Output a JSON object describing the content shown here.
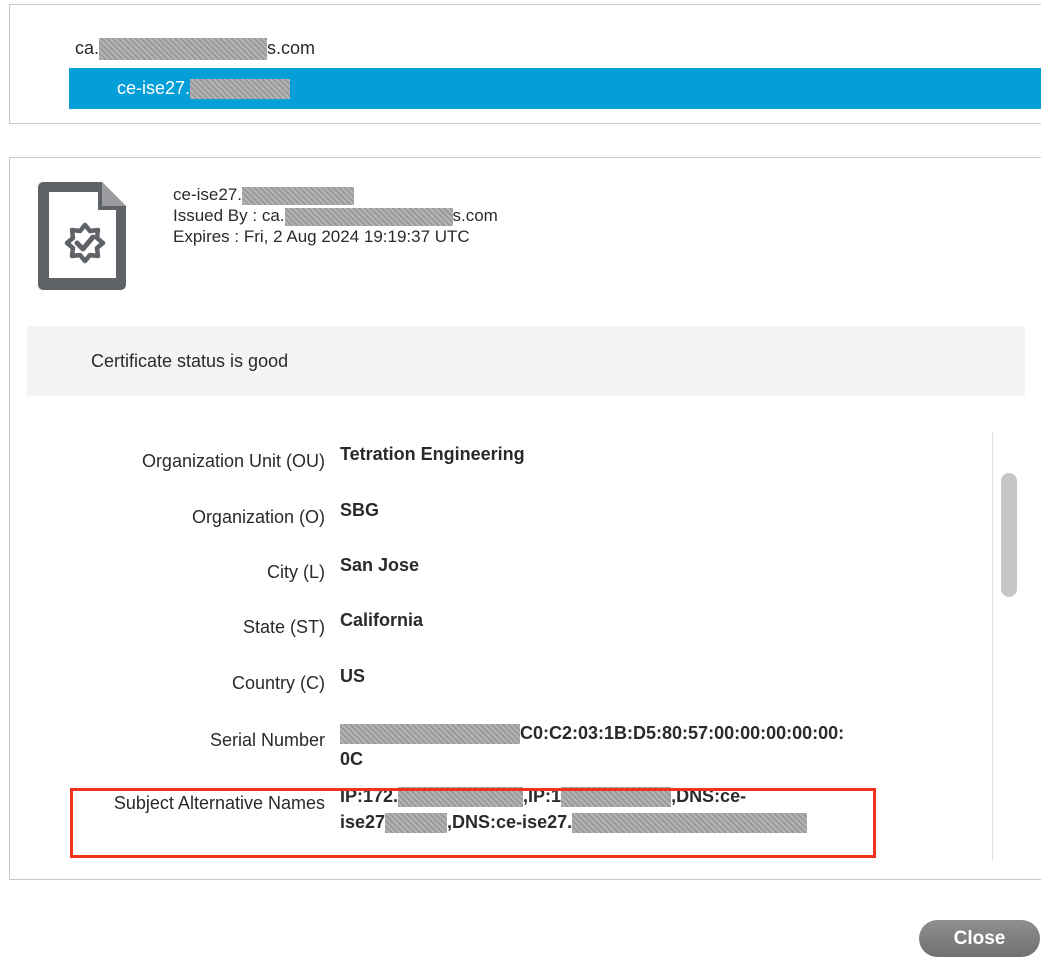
{
  "chain": {
    "root": {
      "prefix": "ca.",
      "suffix": "s.com"
    },
    "selected": {
      "prefix": "ce-ise27."
    }
  },
  "certificate": {
    "subject_prefix": "ce-ise27.",
    "issued_by_label": "Issued By : ca.",
    "issued_by_suffix": "s.com",
    "expires": "Expires : Fri, 2 Aug 2024 19:19:37 UTC",
    "icon": "certificate-badge-icon"
  },
  "status": {
    "text": "Certificate status is good"
  },
  "fields": {
    "ou": {
      "label": "Organization Unit (OU)",
      "value": "Tetration Engineering"
    },
    "o": {
      "label": "Organization (O)",
      "value": "SBG"
    },
    "l": {
      "label": "City (L)",
      "value": "San Jose"
    },
    "st": {
      "label": "State (ST)",
      "value": "California"
    },
    "c": {
      "label": "Country (C)",
      "value": "US"
    },
    "serial": {
      "label": "Serial Number",
      "value_part": "C0:C2:03:1B:D5:80:57:00:00:00:00:00:",
      "value_tail": "0C"
    },
    "san": {
      "label": "Subject Alternative Names",
      "p1": "IP:172.",
      "p2": ",IP:1",
      "p3": ",DNS:ce-",
      "p4": "ise27",
      "p5": ",DNS:ce-ise27."
    }
  },
  "footer": {
    "close_label": "Close"
  },
  "colors": {
    "accent": "#049fd9",
    "highlight": "#f0321e",
    "button": "#7d7f81"
  }
}
